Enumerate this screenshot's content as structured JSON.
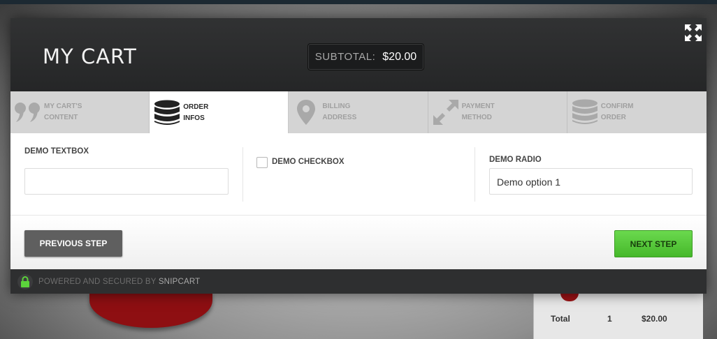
{
  "cart": {
    "title": "MY CART",
    "subtotal_label": "SUBTOTAL:",
    "subtotal_value": "$20.00"
  },
  "steps": [
    {
      "line1": "MY CART'S",
      "line2": "CONTENT",
      "icon": "quote-icon",
      "active": false
    },
    {
      "line1": "ORDER",
      "line2": "INFOS",
      "icon": "database-icon",
      "active": true
    },
    {
      "line1": "BILLING",
      "line2": "ADDRESS",
      "icon": "map-pin-icon",
      "active": false
    },
    {
      "line1": "PAYMENT",
      "line2": "METHOD",
      "icon": "arrows-icon",
      "active": false
    },
    {
      "line1": "CONFIRM",
      "line2": "ORDER",
      "icon": "database-icon",
      "active": false
    }
  ],
  "form": {
    "textbox_label": "DEMO TEXTBOX",
    "textbox_value": "",
    "checkbox_label": "DEMO CHECKBOX",
    "radio_label": "DEMO RADIO",
    "radio_selected": "Demo option 1"
  },
  "buttons": {
    "previous": "PREVIOUS STEP",
    "next": "NEXT STEP"
  },
  "footer": {
    "powered_text": "POWERED AND SECURED BY ",
    "brand": "SNIPCART"
  },
  "background": {
    "total_label": "Total",
    "total_qty": "1",
    "total_value": "$20.00"
  },
  "colors": {
    "accent_green": "#55c63a",
    "header_dark": "#2a2b2c"
  }
}
